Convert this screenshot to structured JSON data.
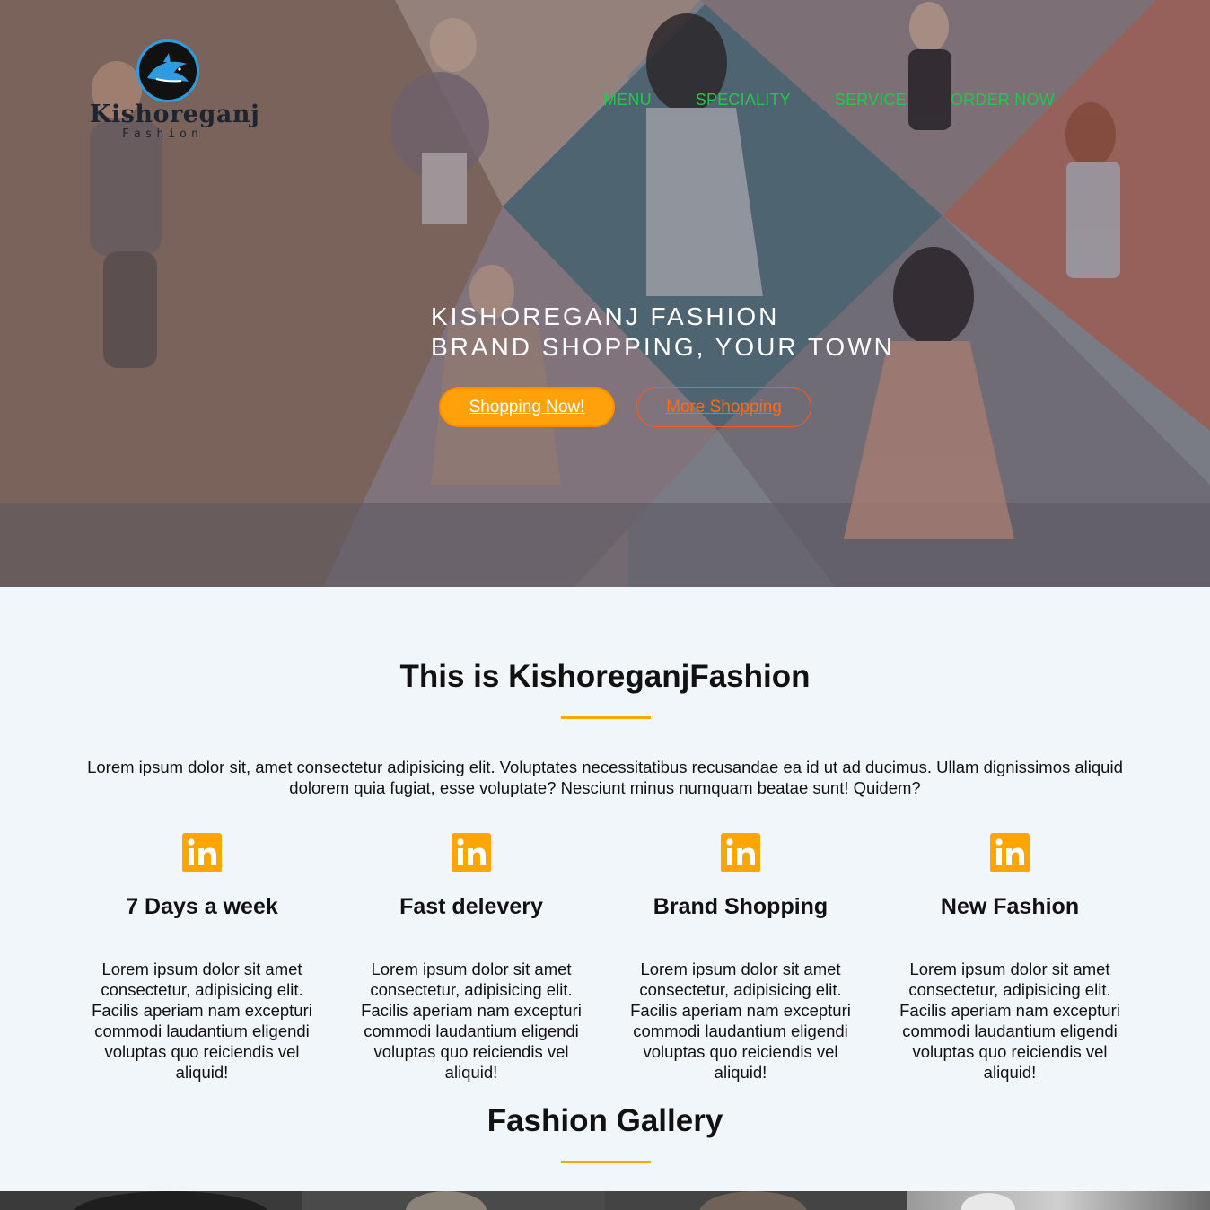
{
  "brand": {
    "name": "Kishoreganj",
    "subtitle": "Fashion"
  },
  "nav": {
    "items": [
      "MENU",
      "SPECIALITY",
      "SERVICE",
      "ORDER NOW"
    ]
  },
  "hero": {
    "line1": "KISHOREGANJ FASHION",
    "line2": "BRAND SHOPPING, YOUR TOWN",
    "primary_button": "Shopping Now!",
    "secondary_button": "More Shopping"
  },
  "about": {
    "title": "This is KishoreganjFashion",
    "text": "Lorem ipsum dolor sit, amet consectetur adipisicing elit. Voluptates necessitatibus recusandae ea id ut ad ducimus. Ullam dignissimos aliquid dolorem quia fugiat, esse voluptate? Nesciunt minus numquam beatae sunt! Quidem?"
  },
  "features": [
    {
      "icon": "linkedin-icon",
      "title": "7 Days a week",
      "text": "Lorem ipsum dolor sit amet consectetur, adipisicing elit. Facilis aperiam nam excepturi commodi laudantium eligendi voluptas quo reiciendis vel aliquid!"
    },
    {
      "icon": "linkedin-icon",
      "title": "Fast delevery",
      "text": "Lorem ipsum dolor sit amet consectetur, adipisicing elit. Facilis aperiam nam excepturi commodi laudantium eligendi voluptas quo reiciendis vel aliquid!"
    },
    {
      "icon": "linkedin-icon",
      "title": "Brand Shopping",
      "text": "Lorem ipsum dolor sit amet consectetur, adipisicing elit. Facilis aperiam nam excepturi commodi laudantium eligendi voluptas quo reiciendis vel aliquid!"
    },
    {
      "icon": "linkedin-icon",
      "title": "New Fashion",
      "text": "Lorem ipsum dolor sit amet consectetur, adipisicing elit. Facilis aperiam nam excepturi commodi laudantium eligendi voluptas quo reiciendis vel aliquid!"
    }
  ],
  "gallery": {
    "title": "Fashion Gallery"
  },
  "colors": {
    "accent": "#ffa500",
    "nav": "#21c94a",
    "button_primary": "#fea10b",
    "button_outline": "#ff5a16",
    "section_bg": "#f1f6fb"
  }
}
